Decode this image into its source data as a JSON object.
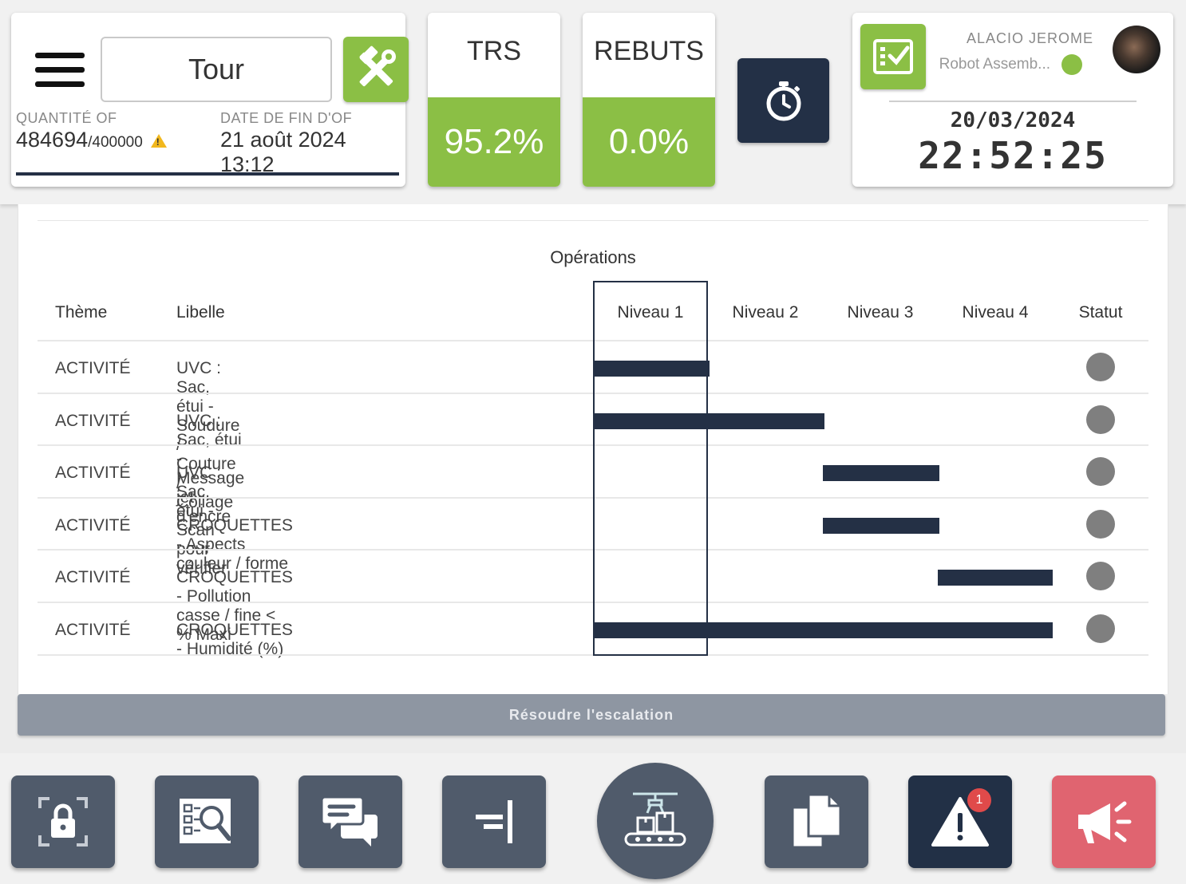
{
  "header": {
    "menu_icon": "hamburger-icon",
    "of_name": "Tour",
    "tools_icon": "tools-icon",
    "quantity_label": "QUANTITÉ OF",
    "quantity_value": "484694",
    "quantity_target": "/400000",
    "quantity_warning_icon": "warning-icon",
    "end_date_label": "DATE DE FIN D'OF",
    "end_date_value": "21 août 2024 13:12"
  },
  "kpis": [
    {
      "title": "TRS",
      "value": "95.2%"
    },
    {
      "title": "REBUTS",
      "value": "0.0%"
    }
  ],
  "timer_icon": "stopwatch-icon",
  "user": {
    "checklist_icon": "checklist-icon",
    "name": "ALACIO JEROME",
    "role": "Robot Assemb...",
    "status_color": "#8bbf45",
    "date": "20/03/2024",
    "time": "22:52:25"
  },
  "operations": {
    "title": "Opérations",
    "columns": {
      "theme": "Thème",
      "libelle": "Libelle",
      "levels": [
        "Niveau 1",
        "Niveau 2",
        "Niveau 3",
        "Niveau 4"
      ],
      "status": "Statut"
    },
    "rows": [
      {
        "theme": "ACTIVITÉ",
        "libelle": "UVC : Sac, étui - Soudure / Couture / Collage",
        "levels": [
          1
        ]
      },
      {
        "theme": "ACTIVITÉ",
        "libelle": "UVC : Sac, étui - Message jet d'encre",
        "levels": [
          1,
          2
        ]
      },
      {
        "theme": "ACTIVITÉ",
        "libelle": "UVC : Sac, étui - Scan pour vérifier",
        "levels": [
          3
        ]
      },
      {
        "theme": "ACTIVITÉ",
        "libelle": "CROQUETTES - Aspects couleur / forme",
        "levels": [
          3
        ]
      },
      {
        "theme": "ACTIVITÉ",
        "libelle": "CROQUETTES - Pollution casse / fine < % Maxi",
        "levels": [
          4
        ]
      },
      {
        "theme": "ACTIVITÉ",
        "libelle": "CROQUETTES - Humidité (%)",
        "levels": [
          1,
          2,
          3,
          4
        ]
      }
    ],
    "selected_level": "Niveau 1",
    "status_color": "#7f7f7f"
  },
  "resolve_button": "Résoudre l'escalation",
  "bottom_bar": {
    "buttons": [
      {
        "icon": "lock-icon"
      },
      {
        "icon": "checklist-search-icon"
      },
      {
        "icon": "chat-icon"
      },
      {
        "icon": "align-right-icon"
      },
      {
        "icon": "conveyor-robot-icon"
      },
      {
        "icon": "documents-icon"
      },
      {
        "icon": "alert-icon",
        "badge": "1"
      },
      {
        "icon": "megaphone-icon"
      }
    ]
  },
  "colors": {
    "accent_green": "#8bbf45",
    "navy": "#243045",
    "slate": "#505b6b",
    "alert_red": "#e06470"
  }
}
